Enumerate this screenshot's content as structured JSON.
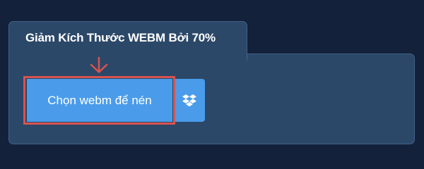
{
  "tab": {
    "title": "Giảm Kích Thước WEBM Bởi 70%"
  },
  "upload": {
    "button_label": "Chọn webm để nén",
    "dropbox_icon": "dropbox-icon",
    "arrow_icon": "arrow-down-icon",
    "highlight_color": "#d9534f",
    "button_color": "#4a9cea"
  }
}
